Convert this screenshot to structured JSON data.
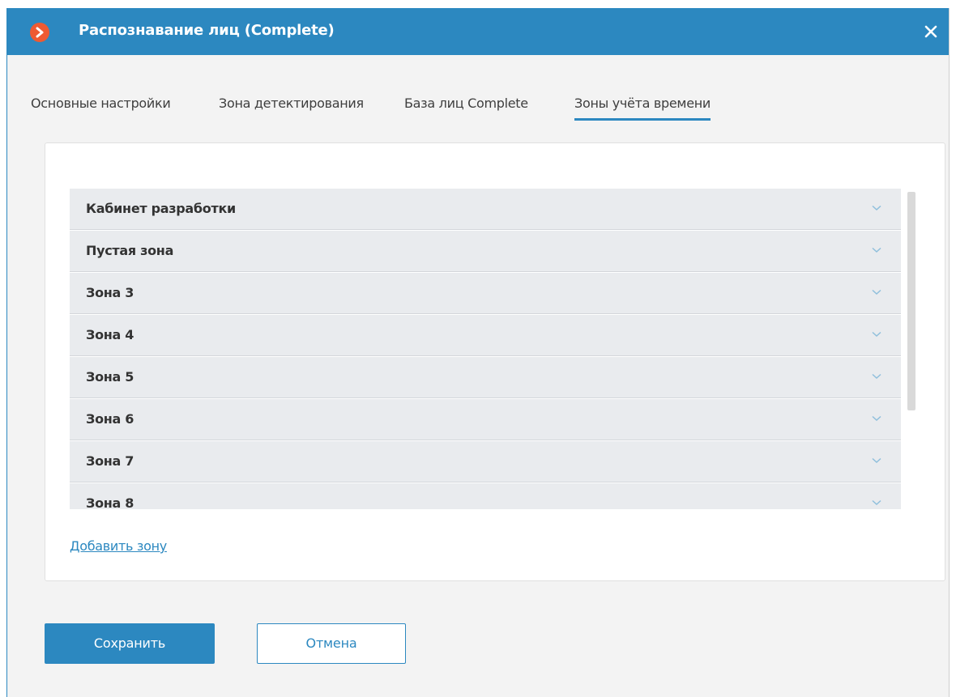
{
  "window": {
    "title": "Распознавание лиц (Complete)",
    "logo_icon": "chevron-right-icon",
    "close_icon": "close-icon",
    "accent_color": "#2c88c0",
    "logo_color": "#ee5a32"
  },
  "tabs": [
    {
      "label": "Основные настройки",
      "active": false
    },
    {
      "label": "Зона детектирования",
      "active": false
    },
    {
      "label": "База лиц Complete",
      "active": false
    },
    {
      "label": "Зоны учёта времени",
      "active": true
    }
  ],
  "zones": [
    {
      "label": "Кабинет разработки",
      "expanded": false
    },
    {
      "label": "Пустая зона",
      "expanded": false
    },
    {
      "label": "Зона 3",
      "expanded": false
    },
    {
      "label": "Зона 4",
      "expanded": false
    },
    {
      "label": "Зона 5",
      "expanded": false
    },
    {
      "label": "Зона 6",
      "expanded": false
    },
    {
      "label": "Зона 7",
      "expanded": false
    },
    {
      "label": "Зона 8",
      "expanded": false
    }
  ],
  "add_zone_label": "Добавить зону",
  "buttons": {
    "save_label": "Сохранить",
    "cancel_label": "Отмена"
  }
}
